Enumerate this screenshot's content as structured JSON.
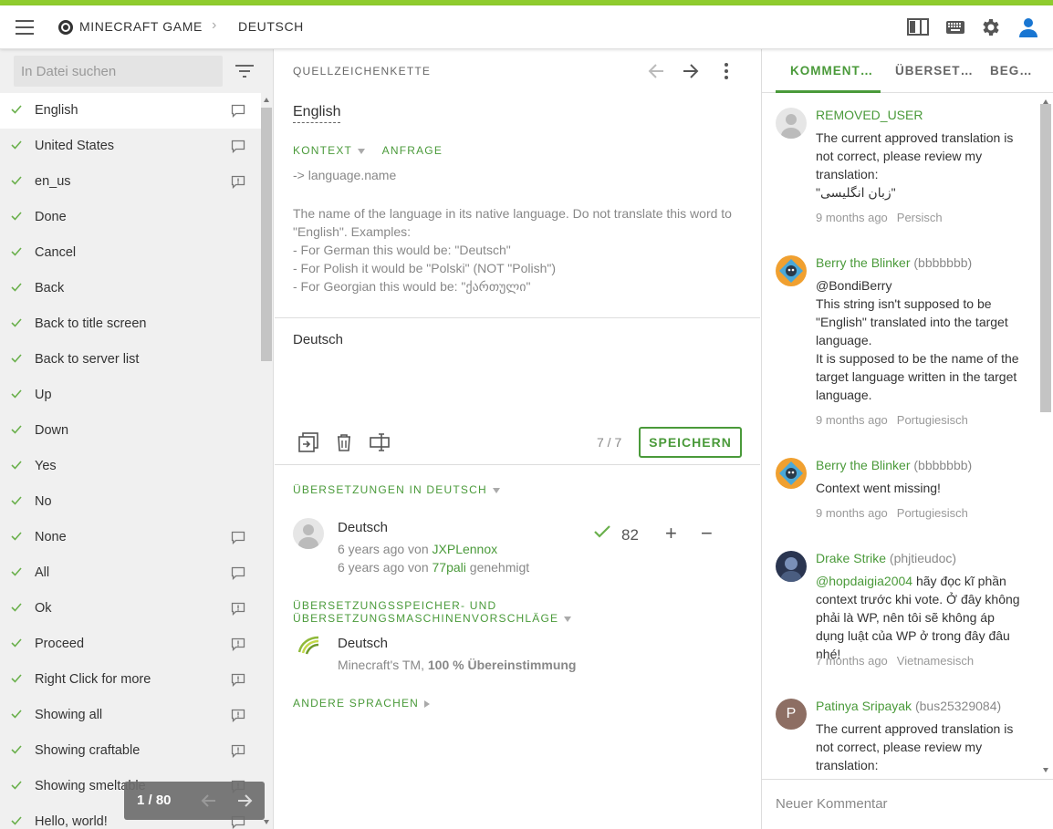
{
  "header": {
    "project": "MINECRAFT GAME",
    "language": "DEUTSCH"
  },
  "sidebar": {
    "search_placeholder": "In Datei suchen",
    "items": [
      {
        "label": "English",
        "icon": "comment"
      },
      {
        "label": "United States",
        "icon": "comment"
      },
      {
        "label": "en_us",
        "icon": "issue"
      },
      {
        "label": "Done",
        "icon": ""
      },
      {
        "label": "Cancel",
        "icon": ""
      },
      {
        "label": "Back",
        "icon": ""
      },
      {
        "label": "Back to title screen",
        "icon": ""
      },
      {
        "label": "Back to server list",
        "icon": ""
      },
      {
        "label": "Up",
        "icon": ""
      },
      {
        "label": "Down",
        "icon": ""
      },
      {
        "label": "Yes",
        "icon": ""
      },
      {
        "label": "No",
        "icon": ""
      },
      {
        "label": "None",
        "icon": "comment"
      },
      {
        "label": "All",
        "icon": "comment"
      },
      {
        "label": "Ok",
        "icon": "issue"
      },
      {
        "label": "Proceed",
        "icon": "issue"
      },
      {
        "label": "Right Click for more",
        "icon": "issue"
      },
      {
        "label": "Showing all",
        "icon": "issue"
      },
      {
        "label": "Showing craftable",
        "icon": "issue"
      },
      {
        "label": "Showing smeltable",
        "icon": "issue"
      },
      {
        "label": "Hello, world!",
        "icon": "comment"
      }
    ],
    "pager": "1 / 80"
  },
  "editor": {
    "source_title": "QUELLZEICHENKETTE",
    "source_text": "English",
    "context_tab": "KONTEXT",
    "request_tab": "ANFRAGE",
    "key": "-> language.name",
    "description": "The name of the language in its native language. Do not translate this word to \"English\". Examples:\n- For German this would be: \"Deutsch\"\n- For Polish it would be \"Polski\" (NOT \"Polish\")\n- For Georgian this would be: \"ქართული\"",
    "target_text": "Deutsch",
    "count": "7 / 7",
    "save_label": "SPEICHERN",
    "translations_title": "ÜBERSETZUNGEN IN DEUTSCH",
    "suggestion": {
      "text": "Deutsch",
      "meta1_prefix": "6 years ago von ",
      "meta1_user": "JXPLennox",
      "meta2_prefix": "6 years ago von ",
      "meta2_user": "77pali",
      "meta2_suffix": " genehmigt",
      "votes": "82"
    },
    "tm_title": "ÜBERSETZUNGSSPEICHER- UND ÜBERSETZUNGSMASCHINENVORSCHLÄGE",
    "tm": {
      "text": "Deutsch",
      "source": "Minecraft's TM, ",
      "match": "100 % Übereinstimmung"
    },
    "other_languages": "ANDERE SPRACHEN"
  },
  "comments_panel": {
    "tabs": [
      "KOMMENT…",
      "ÜBERSET…",
      "BEG…"
    ],
    "comments": [
      {
        "name": "REMOVED_USER",
        "uid": "",
        "body": "The current approved translation is not correct, please review my translation:\n\"زبان انگلیسی\"",
        "time": "9 months ago",
        "lang": "Persisch"
      },
      {
        "name": "Berry the Blinker",
        "uid": "(bbbbbbb)",
        "body": "@BondiBerry\nThis string isn't supposed to be \"English\" translated into the target language.\nIt is supposed to be the name of the target language written in the target language.",
        "time": "9 months ago",
        "lang": "Portugiesisch"
      },
      {
        "name": "Berry the Blinker",
        "uid": "(bbbbbbb)",
        "body": "Context went missing!",
        "time": "9 months ago",
        "lang": "Portugiesisch"
      },
      {
        "name": "Drake Strike",
        "uid": "(phjtieudoc)",
        "mention": "@hopdaigia2004",
        "body": " hãy đọc kĩ phần context trước khi vote. Ở đây không phải là WP, nên tôi sẽ không áp dụng luật của WP ở trong đây đâu nhé!",
        "time": "7 months ago",
        "lang": "Vietnamesisch"
      },
      {
        "name": "Patinya Sripayak",
        "uid": "(bus25329084)",
        "avatar_letter": "P",
        "body": "The current approved translation is not correct, please review my translation:",
        "time": "",
        "lang": ""
      }
    ],
    "new_comment_placeholder": "Neuer Kommentar"
  },
  "colors": {
    "accent": "#8fcc2e",
    "green": "#4a9a3a"
  }
}
